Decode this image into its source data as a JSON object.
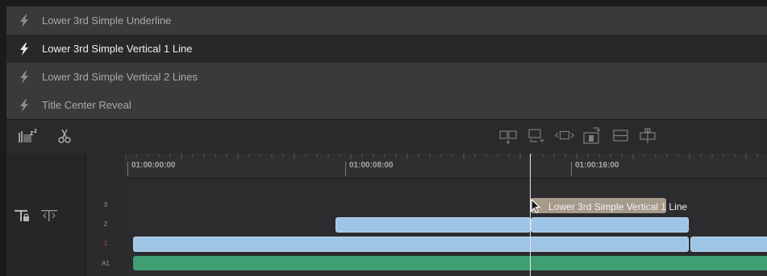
{
  "effects": [
    {
      "label": "Lower 3rd Simple Underline",
      "selected": false
    },
    {
      "label": "Lower 3rd Simple Vertical 1 Line",
      "selected": true
    },
    {
      "label": "Lower 3rd Simple Vertical 2 Lines",
      "selected": false
    },
    {
      "label": "Title Center Reveal",
      "selected": false
    }
  ],
  "toolbar": {
    "left_icons": [
      "snap-zz-icon",
      "scissors-icon"
    ],
    "edit_icons": [
      "insert-icon",
      "overwrite-icon",
      "replace-icon",
      "fit-to-fill-icon",
      "place-on-top-icon",
      "ripple-overwrite-icon"
    ]
  },
  "ruler": {
    "timecodes": [
      "01:00:00:00",
      "01:00:08:00",
      "01:00:16:00"
    ]
  },
  "tracks": {
    "labels": [
      "3",
      "2",
      "1",
      "A1"
    ],
    "active_track": "1"
  },
  "title_clip": {
    "label": "Lower 3rd Simple Vertical 1 Line"
  },
  "colors": {
    "video_clip": "#9ec4e6",
    "audio_clip": "#3f9e72",
    "title_clip": "#a69a8a",
    "selected_row": "#28282a",
    "active_track_label": "#d04040"
  }
}
